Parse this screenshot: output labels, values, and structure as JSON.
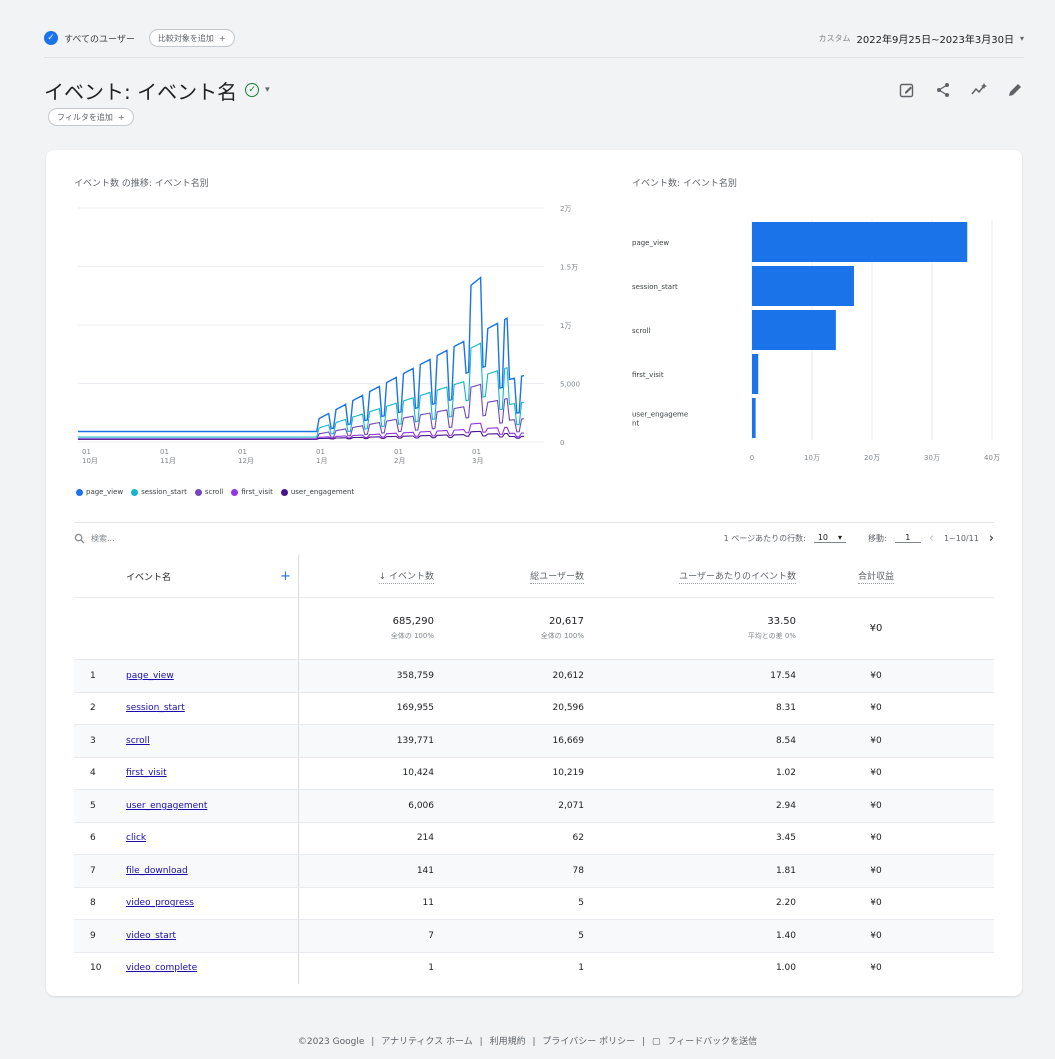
{
  "segment": {
    "icon_text": "✓",
    "label": "すべてのユーザー"
  },
  "compare": {
    "label": "比較対象を追加",
    "plus": "+"
  },
  "date": {
    "custom": "カスタム",
    "range": "2022年9月25日~2023年3月30日",
    "caret": "▾"
  },
  "title": {
    "text": "イベント: イベント名",
    "caret": "▾"
  },
  "filter": {
    "label": "フィルタを追加",
    "plus": "+"
  },
  "icons": [
    "edit-report-icon",
    "share-icon",
    "insights-icon",
    "pencil-icon"
  ],
  "line_chart_title": "イベント数 の推移: イベント名別",
  "bar_chart_title": "イベント数: イベント名別",
  "chart_data": [
    {
      "type": "line",
      "title": "イベント数 の推移: イベント名別",
      "x_ticks": [
        [
          "01",
          "10月"
        ],
        [
          "01",
          "11月"
        ],
        [
          "01",
          "12月"
        ],
        [
          "01",
          "1月"
        ],
        [
          "01",
          "2月"
        ],
        [
          "01",
          "3月"
        ]
      ],
      "y_ticks": [
        "0",
        "5,000",
        "1万",
        "1.5万",
        "2万"
      ],
      "ylim": [
        0,
        20000
      ],
      "series": [
        {
          "name": "page_view",
          "color": "#1a73e8"
        },
        {
          "name": "session_start",
          "color": "#12b5cb"
        },
        {
          "name": "scroll",
          "color": "#7248b9"
        },
        {
          "name": "first_visit",
          "color": "#9334e6"
        },
        {
          "name": "user_engagement",
          "color": "#4a148c"
        }
      ]
    },
    {
      "type": "bar",
      "title": "イベント数: イベント名別",
      "categories": [
        "page_view",
        "session_start",
        "scroll",
        "first_visit",
        "user_engageme nt"
      ],
      "values": [
        358759,
        169955,
        139771,
        10424,
        6006
      ],
      "x_ticks": [
        "0",
        "10万",
        "20万",
        "30万",
        "40万"
      ],
      "xlim": [
        0,
        400000
      ],
      "color": "#1a73e8"
    }
  ],
  "search": {
    "placeholder": "検索..."
  },
  "pager": {
    "rows_label": "1 ページあたりの行数:",
    "rows_value": "10",
    "goto_label": "移動:",
    "goto_value": "1",
    "range": "1~10/11",
    "prev": "‹",
    "next": "›"
  },
  "table": {
    "headers": {
      "name": "イベント名",
      "events": "↓ イベント数",
      "users": "総ユーザー数",
      "per_user": "ユーザーあたりのイベント数",
      "revenue": "合計収益"
    },
    "totals": {
      "events": "685,290",
      "events_sub": "全体の 100%",
      "users": "20,617",
      "users_sub": "全体の 100%",
      "per_user": "33.50",
      "per_user_sub": "平均との差 0%",
      "revenue": "¥0"
    },
    "rows": [
      {
        "idx": "1",
        "name": "page_view",
        "events": "358,759",
        "users": "20,612",
        "per_user": "17.54",
        "revenue": "¥0"
      },
      {
        "idx": "2",
        "name": "session_start",
        "events": "169,955",
        "users": "20,596",
        "per_user": "8.31",
        "revenue": "¥0"
      },
      {
        "idx": "3",
        "name": "scroll",
        "events": "139,771",
        "users": "16,669",
        "per_user": "8.54",
        "revenue": "¥0"
      },
      {
        "idx": "4",
        "name": "first_visit",
        "events": "10,424",
        "users": "10,219",
        "per_user": "1.02",
        "revenue": "¥0"
      },
      {
        "idx": "5",
        "name": "user_engagement",
        "events": "6,006",
        "users": "2,071",
        "per_user": "2.94",
        "revenue": "¥0"
      },
      {
        "idx": "6",
        "name": "click",
        "events": "214",
        "users": "62",
        "per_user": "3.45",
        "revenue": "¥0"
      },
      {
        "idx": "7",
        "name": "file_download",
        "events": "141",
        "users": "78",
        "per_user": "1.81",
        "revenue": "¥0"
      },
      {
        "idx": "8",
        "name": "video_progress",
        "events": "11",
        "users": "5",
        "per_user": "2.20",
        "revenue": "¥0"
      },
      {
        "idx": "9",
        "name": "video_start",
        "events": "7",
        "users": "5",
        "per_user": "1.40",
        "revenue": "¥0"
      },
      {
        "idx": "10",
        "name": "video_complete",
        "events": "1",
        "users": "1",
        "per_user": "1.00",
        "revenue": "¥0"
      }
    ]
  },
  "footer": {
    "copyright": "©2023 Google",
    "links": [
      "アナリティクス ホーム",
      "利用規約",
      "プライバシー ポリシー"
    ],
    "feedback": "フィードバックを送信",
    "sep": "|"
  }
}
